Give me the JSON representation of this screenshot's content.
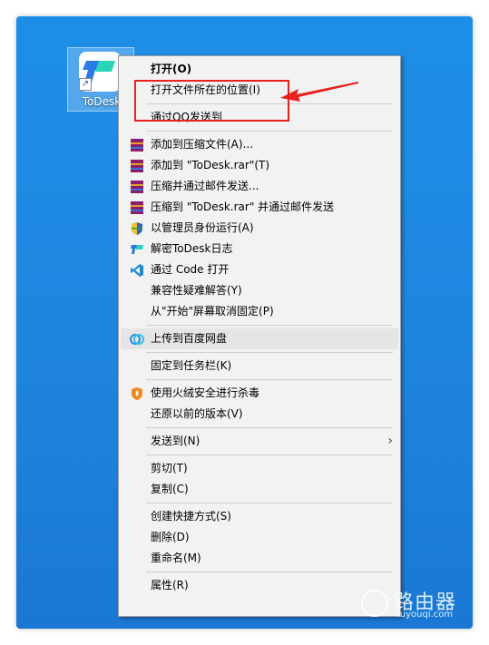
{
  "desktop": {
    "icon_label": "ToDesk",
    "icon_name": "todesk-app-icon"
  },
  "context_menu": {
    "items": [
      {
        "label": "打开(O)",
        "icon": ""
      },
      {
        "label": "打开文件所在的位置(I)",
        "icon": ""
      },
      {
        "label": "通过QQ发送到",
        "icon": ""
      },
      {
        "label": "添加到压缩文件(A)...",
        "icon": "winrar-icon"
      },
      {
        "label": "添加到 \"ToDesk.rar\"(T)",
        "icon": "winrar-icon"
      },
      {
        "label": "压缩并通过邮件发送...",
        "icon": "winrar-icon"
      },
      {
        "label": "压缩到 \"ToDesk.rar\" 并通过邮件发送",
        "icon": "winrar-icon"
      },
      {
        "label": "以管理员身份运行(A)",
        "icon": "uac-shield-icon"
      },
      {
        "label": "解密ToDesk日志",
        "icon": "todesk-icon"
      },
      {
        "label": "通过 Code 打开",
        "icon": "vscode-icon"
      },
      {
        "label": "兼容性疑难解答(Y)",
        "icon": ""
      },
      {
        "label": "从\"开始\"屏幕取消固定(P)",
        "icon": ""
      },
      {
        "label": "上传到百度网盘",
        "icon": "baidu-netdisk-icon"
      },
      {
        "label": "固定到任务栏(K)",
        "icon": ""
      },
      {
        "label": "使用火绒安全进行杀毒",
        "icon": "huorong-icon"
      },
      {
        "label": "还原以前的版本(V)",
        "icon": ""
      },
      {
        "label": "发送到(N)",
        "icon": ""
      },
      {
        "label": "剪切(T)",
        "icon": ""
      },
      {
        "label": "复制(C)",
        "icon": ""
      },
      {
        "label": "创建快捷方式(S)",
        "icon": ""
      },
      {
        "label": "删除(D)",
        "icon": ""
      },
      {
        "label": "重命名(M)",
        "icon": ""
      },
      {
        "label": "属性(R)",
        "icon": ""
      }
    ],
    "submenu_chevron": "›"
  },
  "annotation": {
    "color": "#e8211c"
  },
  "watermark": {
    "title": "路由器",
    "url": "luyouqi.com"
  }
}
